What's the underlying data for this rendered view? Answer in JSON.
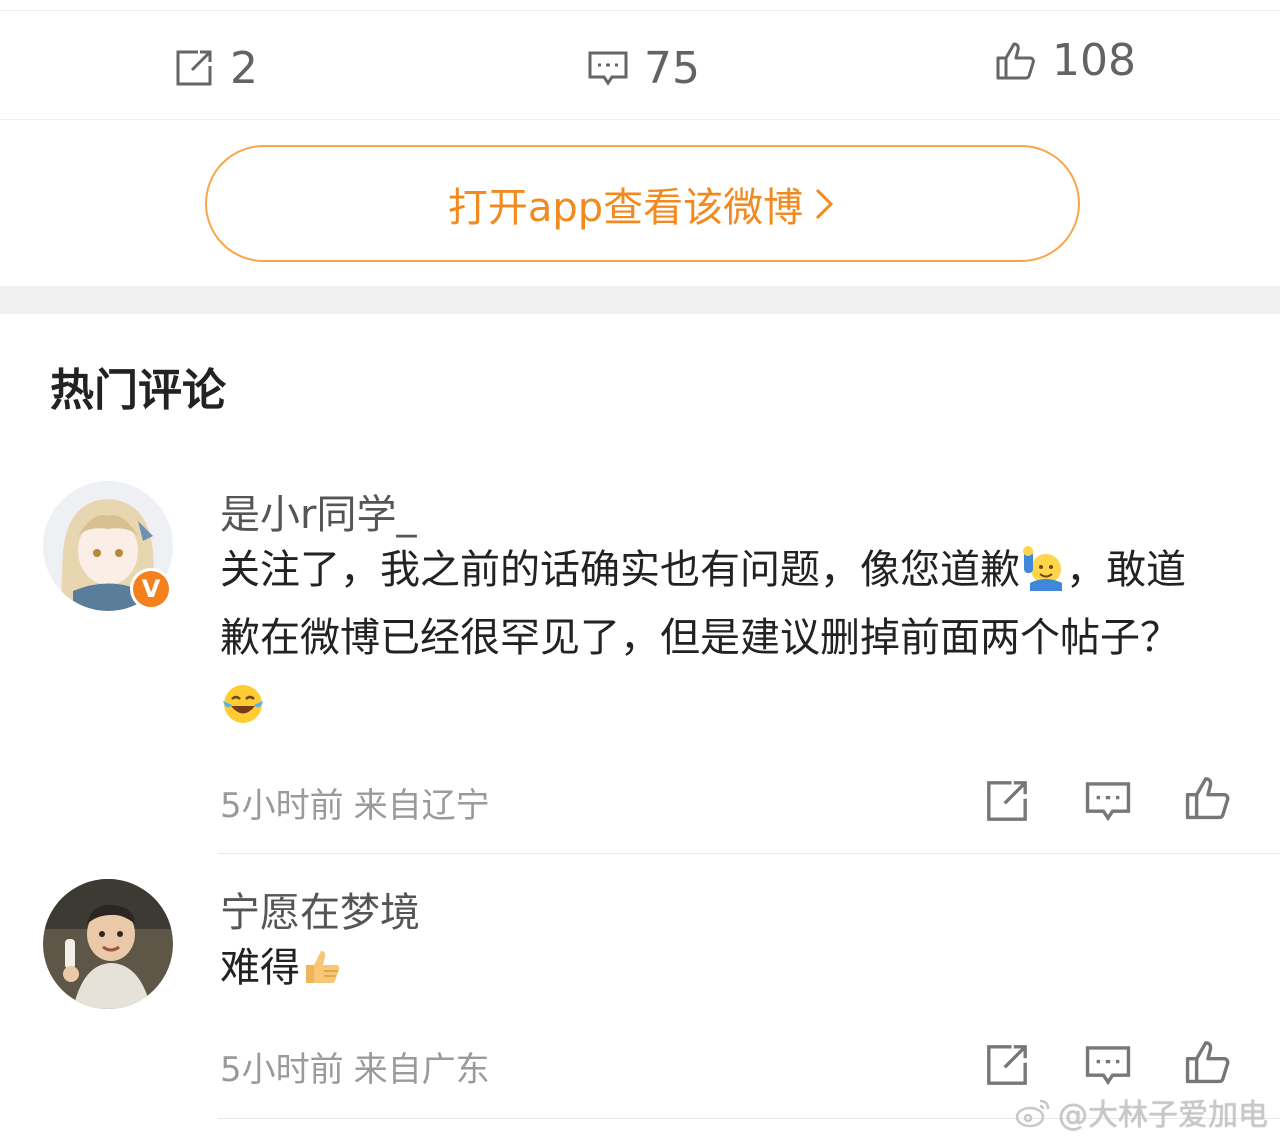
{
  "actions": {
    "repost_count": "2",
    "comment_count": "75",
    "like_count": "108"
  },
  "open_app": {
    "label": "打开app查看该微博"
  },
  "section_title": "热门评论",
  "comments": [
    {
      "username": "是小r同学_",
      "text_parts": [
        "关注了，我之前的话确实也有问题，像您道歉",
        "，敢道歉在微博已经很罕见了，但是建议删掉前面两个帖子？"
      ],
      "emojis": [
        "raising-hand-emoji",
        "laughing-crying-emoji"
      ],
      "verified_badge": "V",
      "time": "5小时前",
      "location": "来自辽宁"
    },
    {
      "username": "宁愿在梦境",
      "text": "难得",
      "emojis": [
        "thumbs-up-emoji"
      ],
      "time": "5小时前",
      "location": "来自广东"
    }
  ],
  "watermark": "@大林子爱加电",
  "colors": {
    "accent": "#f28a1f",
    "badge": "#f5811e",
    "meta_gray": "#9a9a9a"
  }
}
